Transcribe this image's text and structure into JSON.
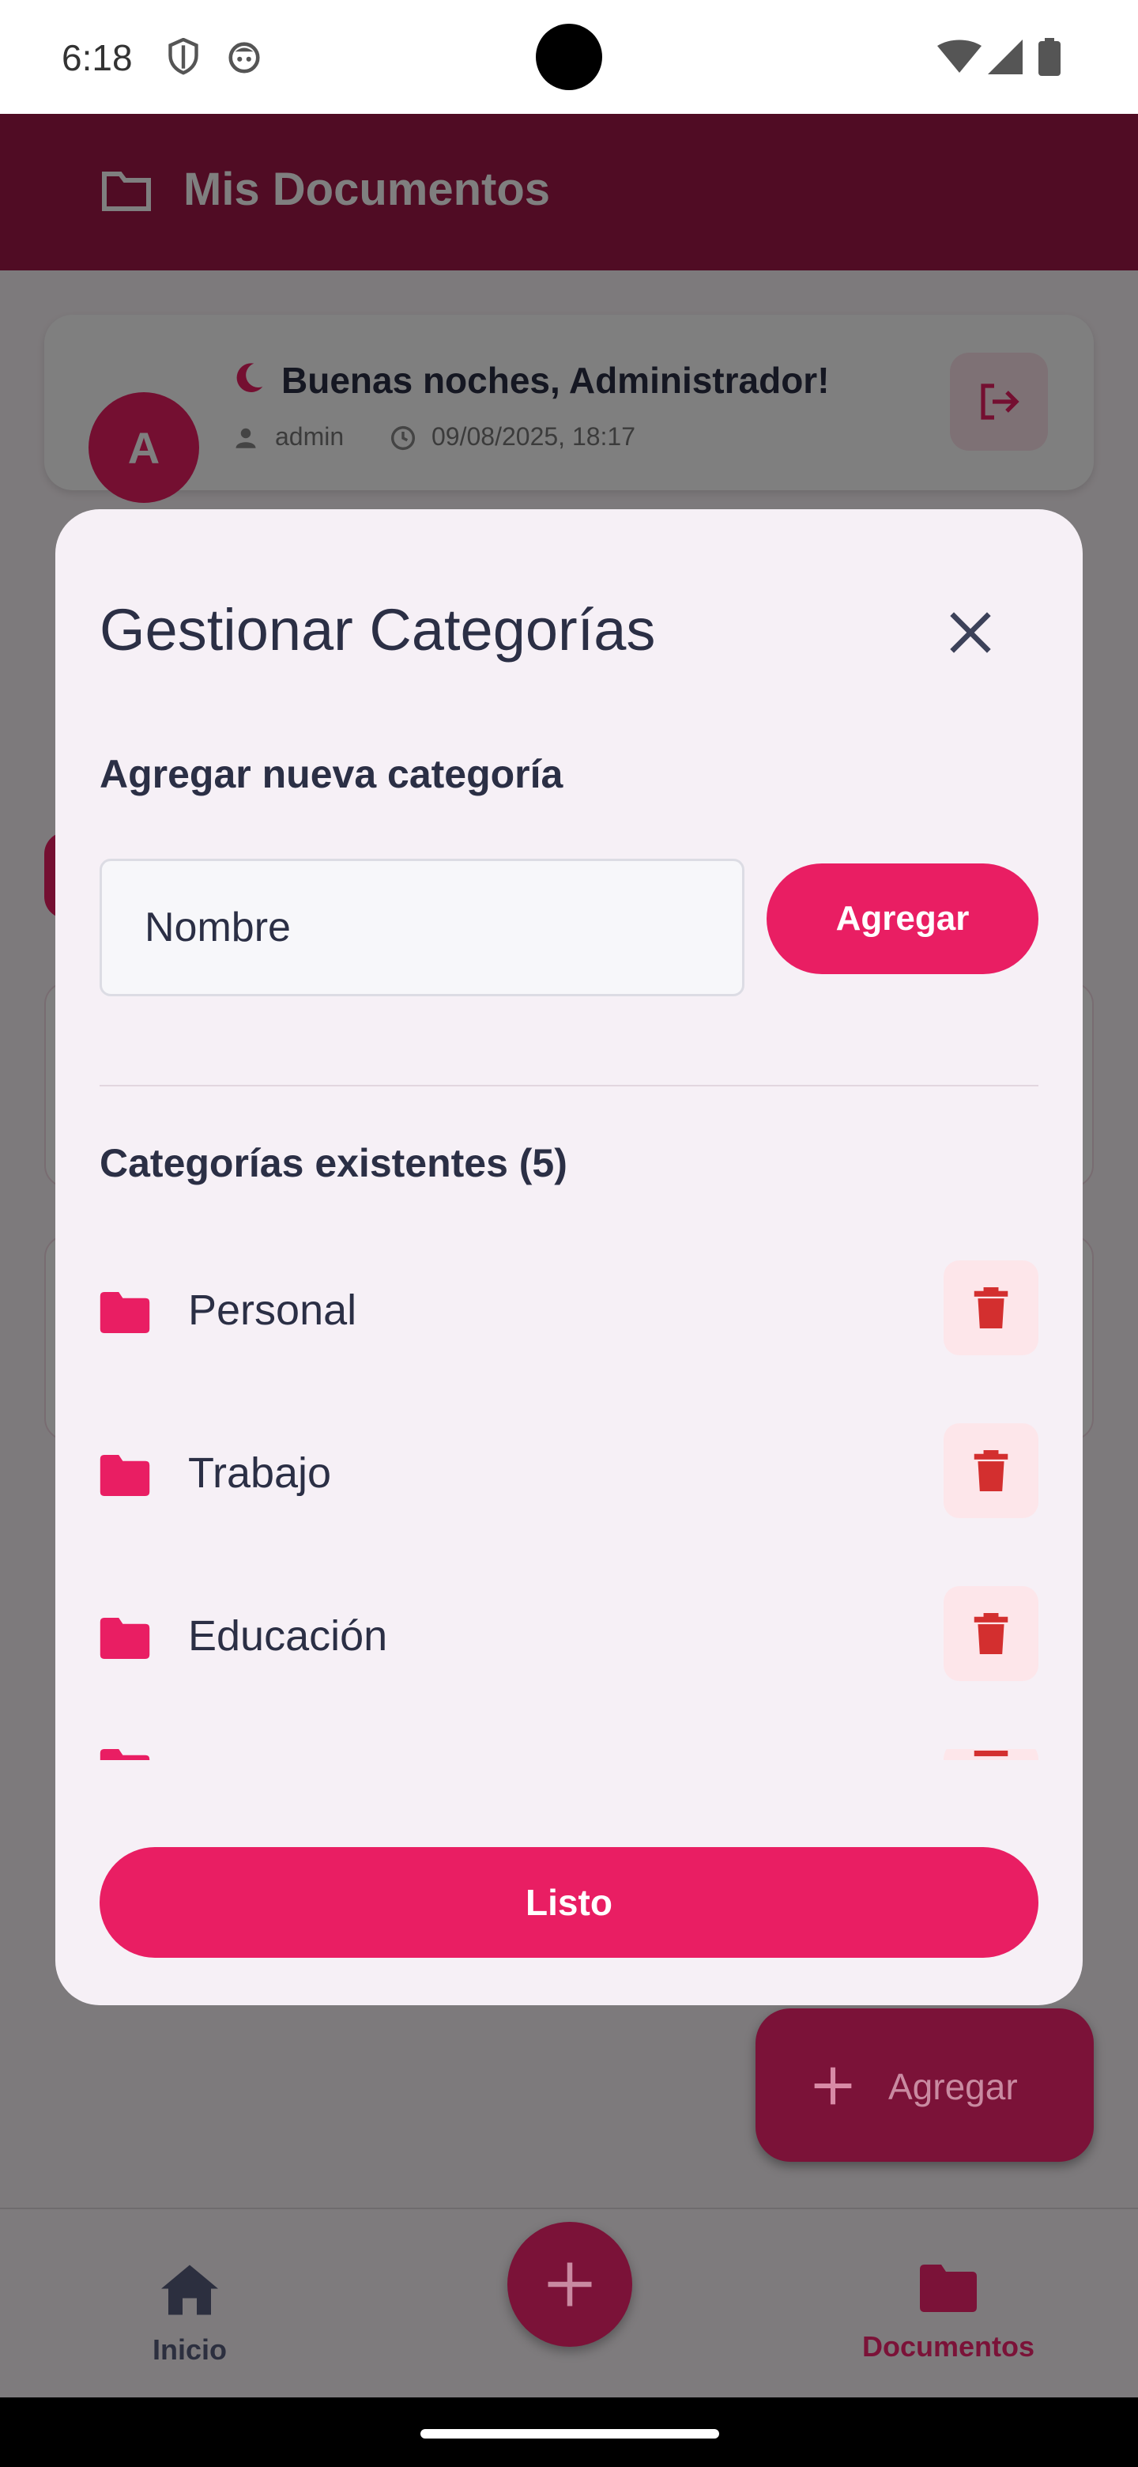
{
  "status_bar": {
    "time": "6:18",
    "icons": [
      "shield-icon",
      "robot-face-icon",
      "wifi-icon",
      "signal-icon",
      "battery-icon"
    ]
  },
  "app_bar": {
    "title": "Mis Documentos",
    "icon": "folder-outline-icon"
  },
  "greeting": {
    "avatar_letter": "A",
    "title": "Buenas noches, Administrador!",
    "user": "admin",
    "datetime": "09/08/2025, 18:17"
  },
  "dialog": {
    "title": "Gestionar Categorías",
    "add_section_label": "Agregar nueva categoría",
    "name_placeholder": "Nombre",
    "add_button_label": "Agregar",
    "existing_label": "Categorías existentes (5)",
    "categories": [
      {
        "name": "Personal"
      },
      {
        "name": "Trabajo"
      },
      {
        "name": "Educación"
      }
    ],
    "done_button_label": "Listo"
  },
  "fab": {
    "label": "Agregar"
  },
  "bottom_nav": {
    "items": [
      {
        "label": "Inicio",
        "icon": "home-icon"
      },
      {
        "label": "Documentos",
        "icon": "folder-icon"
      }
    ]
  },
  "colors": {
    "primary": "#e91e63",
    "app_bar": "#a01848",
    "dialog_bg": "#f6f0f6",
    "text": "#2b2f45",
    "delete_icon": "#d32f2f",
    "delete_bg": "#fde6ea"
  }
}
